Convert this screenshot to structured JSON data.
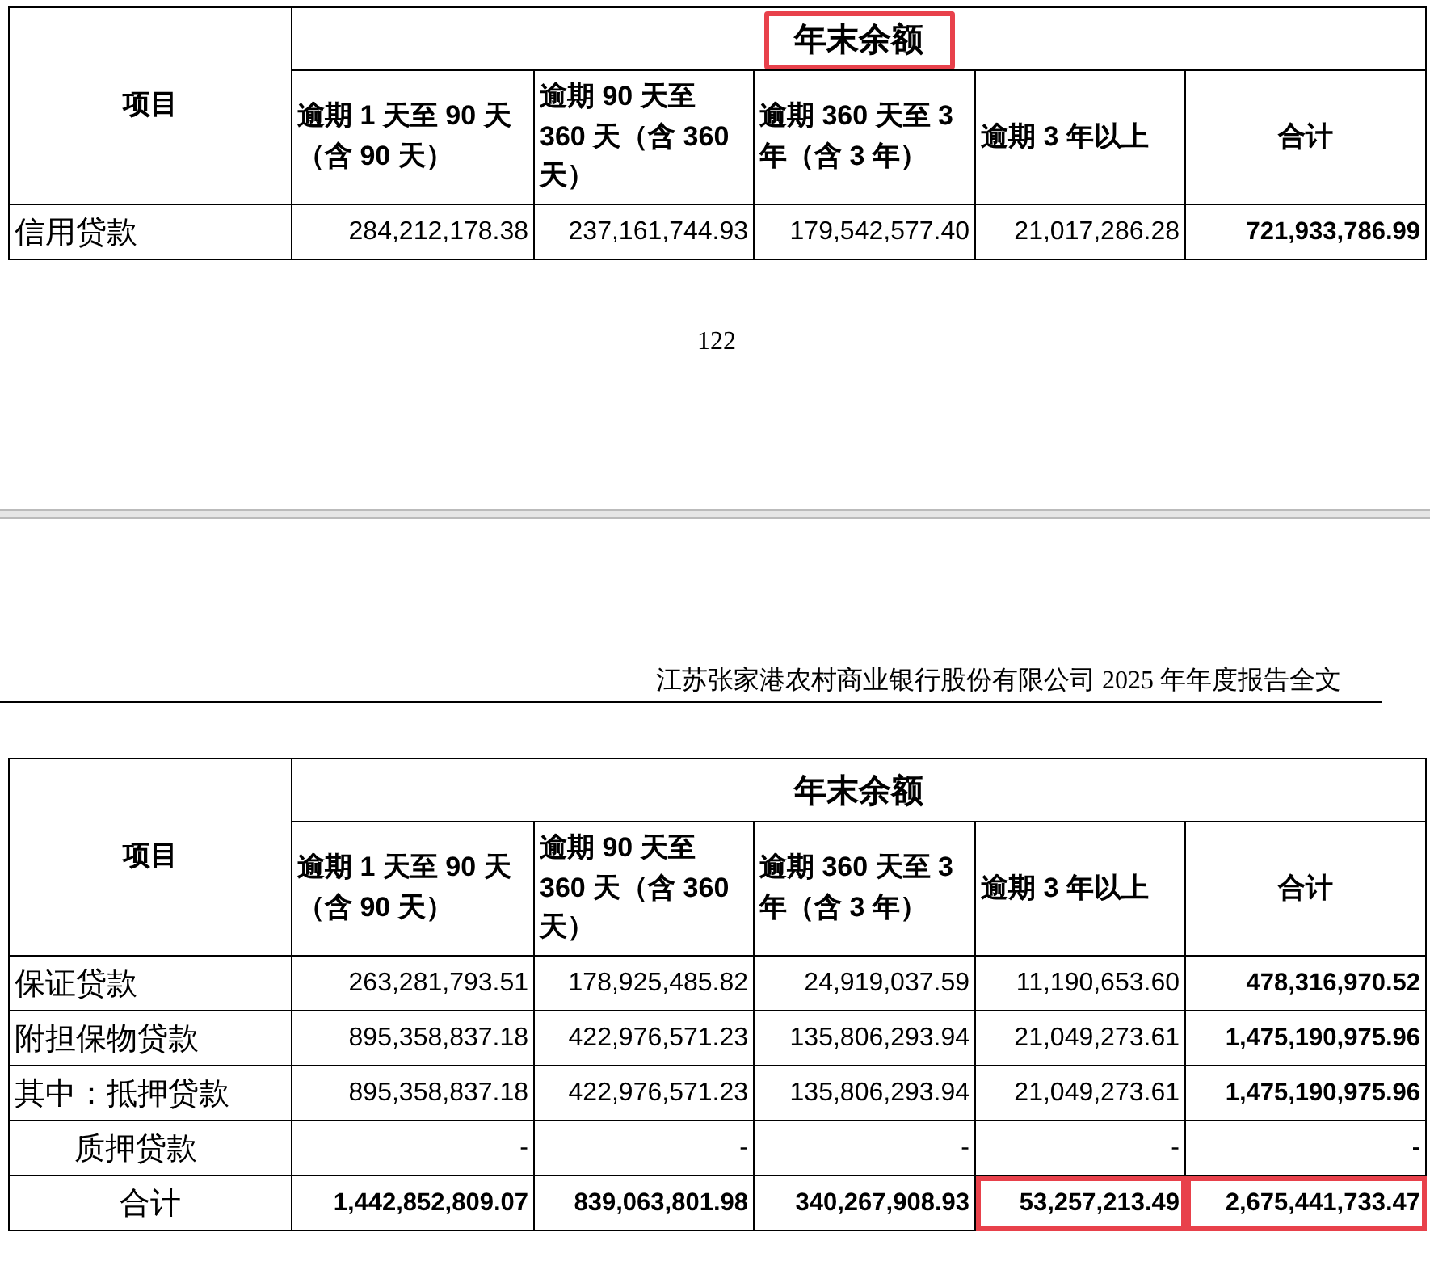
{
  "pages": [
    {
      "table": {
        "title": {
          "text": "年末余额",
          "highlighted": true
        },
        "row_header": "项目",
        "columns": [
          "逾期 1 天至 90 天（含 90 天）",
          "逾期 90 天至 360 天（含 360 天）",
          "逾期 360 天至 3 年（含 3 年）",
          "逾期 3 年以上",
          "合计"
        ],
        "rows": [
          {
            "kind": "item",
            "label": "信用贷款",
            "cells": [
              {
                "text": "284,212,178.38",
                "highlighted": false
              },
              {
                "text": "237,161,744.93",
                "highlighted": false
              },
              {
                "text": "179,542,577.40",
                "highlighted": false
              },
              {
                "text": "21,017,286.28",
                "highlighted": false
              },
              {
                "text": "721,933,786.99",
                "highlighted": false
              }
            ]
          }
        ]
      },
      "page_number": "122"
    },
    {
      "running_header": "江苏张家港农村商业银行股份有限公司 2025 年年度报告全文",
      "table": {
        "title": {
          "text": "年末余额",
          "highlighted": false
        },
        "row_header": "项目",
        "columns": [
          "逾期 1 天至 90 天（含 90 天）",
          "逾期 90 天至 360 天（含 360 天）",
          "逾期 360 天至 3 年（含 3 年）",
          "逾期 3 年以上",
          "合计"
        ],
        "rows": [
          {
            "kind": "item",
            "label": "保证贷款",
            "cells": [
              {
                "text": "263,281,793.51",
                "highlighted": false
              },
              {
                "text": "178,925,485.82",
                "highlighted": false
              },
              {
                "text": "24,919,037.59",
                "highlighted": false
              },
              {
                "text": "11,190,653.60",
                "highlighted": false
              },
              {
                "text": "478,316,970.52",
                "highlighted": false
              }
            ]
          },
          {
            "kind": "item",
            "label": "附担保物贷款",
            "cells": [
              {
                "text": "895,358,837.18",
                "highlighted": false
              },
              {
                "text": "422,976,571.23",
                "highlighted": false
              },
              {
                "text": "135,806,293.94",
                "highlighted": false
              },
              {
                "text": "21,049,273.61",
                "highlighted": false
              },
              {
                "text": "1,475,190,975.96",
                "highlighted": false
              }
            ]
          },
          {
            "kind": "item",
            "label": "其中：抵押贷款",
            "cells": [
              {
                "text": "895,358,837.18",
                "highlighted": false
              },
              {
                "text": "422,976,571.23",
                "highlighted": false
              },
              {
                "text": "135,806,293.94",
                "highlighted": false
              },
              {
                "text": "21,049,273.61",
                "highlighted": false
              },
              {
                "text": "1,475,190,975.96",
                "highlighted": false
              }
            ]
          },
          {
            "kind": "sub",
            "label": "质押贷款",
            "cells": [
              {
                "text": "-",
                "highlighted": false
              },
              {
                "text": "-",
                "highlighted": false
              },
              {
                "text": "-",
                "highlighted": false
              },
              {
                "text": "-",
                "highlighted": false
              },
              {
                "text": "-",
                "highlighted": false
              }
            ]
          },
          {
            "kind": "total",
            "label": "合计",
            "cells": [
              {
                "text": "1,442,852,809.07",
                "highlighted": false
              },
              {
                "text": "839,063,801.98",
                "highlighted": false
              },
              {
                "text": "340,267,908.93",
                "highlighted": false
              },
              {
                "text": "53,257,213.49",
                "highlighted": true
              },
              {
                "text": "2,675,441,733.47",
                "highlighted": true
              }
            ]
          }
        ]
      }
    }
  ]
}
